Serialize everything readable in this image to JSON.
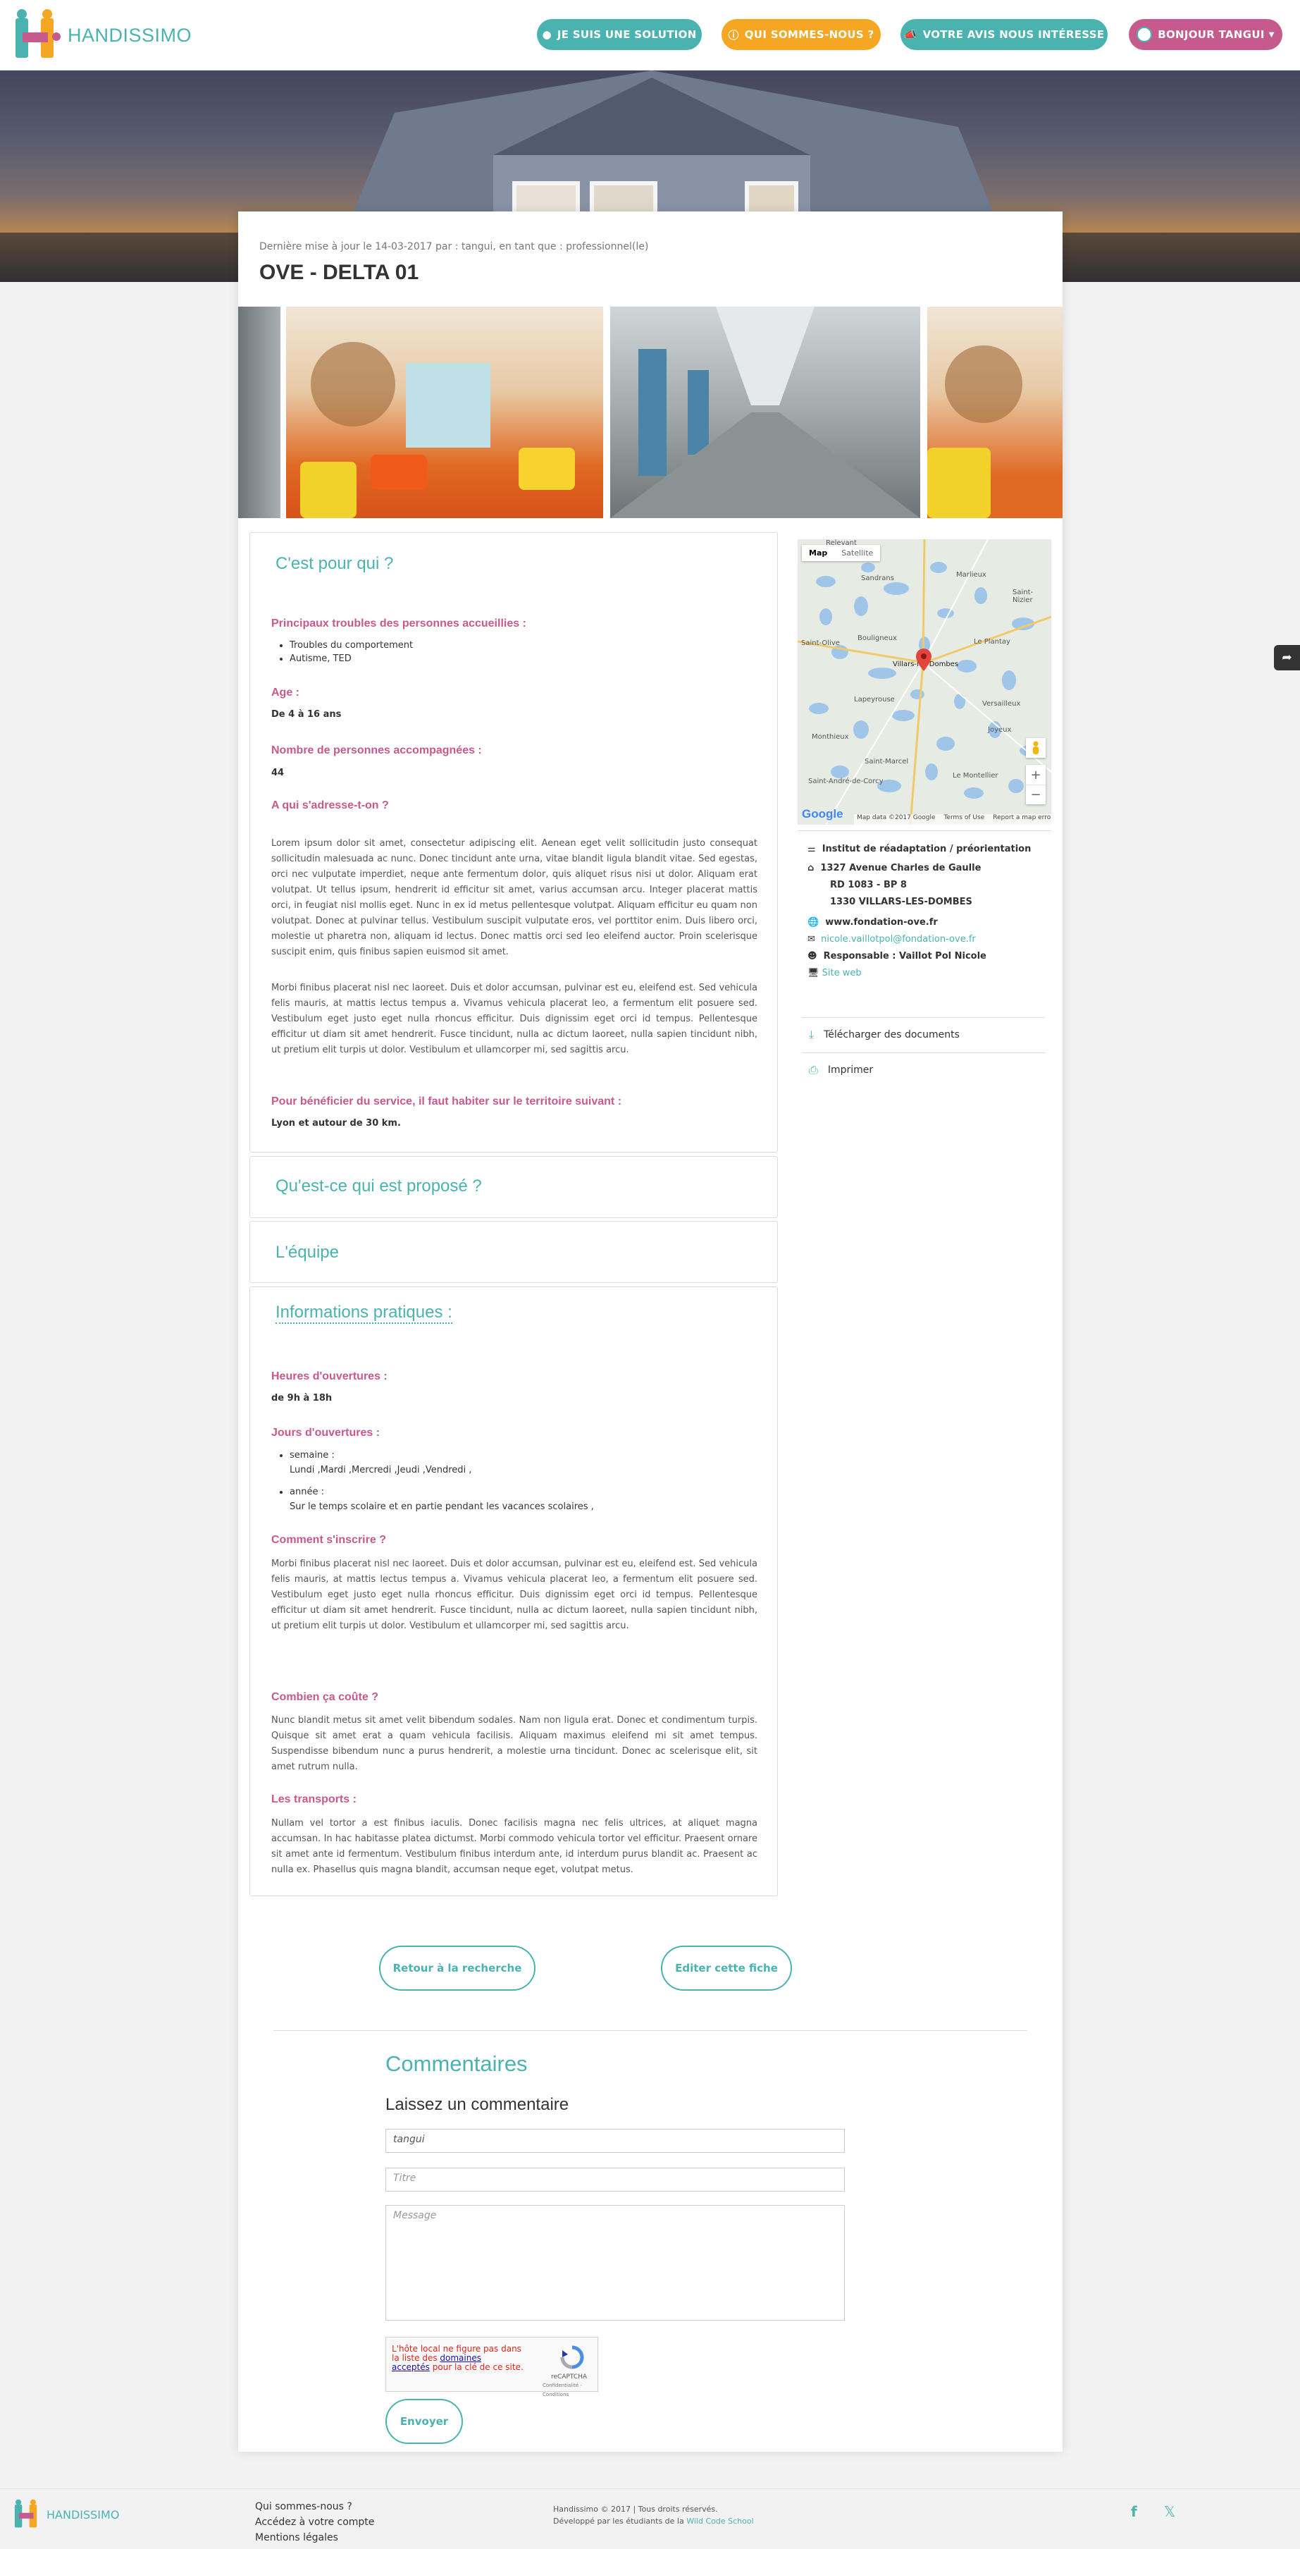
{
  "nav": {
    "brand": "HANDISSIMO",
    "btn_solution": "JE SUIS UNE SOLUTION",
    "btn_qui": "QUI SOMMES-NOUS ?",
    "btn_avis": "VOTRE AVIS NOUS INTÉRESSE",
    "btn_user": "BONJOUR TANGUI",
    "colors": {
      "teal": "#4ab3b0",
      "orange": "#f5a623",
      "pink": "#c65a8c"
    }
  },
  "header": {
    "updated": "Dernière mise à jour le 14-03-2017 par : tangui, en tant que : professionnel(le)",
    "title": "OVE - DELTA 01"
  },
  "who": {
    "heading": "C'est pour qui ?",
    "troubles_label": "Principaux troubles des personnes accueillies :",
    "troubles": [
      "Troubles du comportement",
      "Autisme, TED"
    ],
    "age_label": "Age :",
    "age_value": "De 4 à 16 ans",
    "count_label": "Nombre de personnes accompagnées :",
    "count_value": "44",
    "target_label": "A qui s'adresse-t-on ?",
    "target_p1": "Lorem ipsum dolor sit amet, consectetur adipiscing elit. Aenean eget velit sollicitudin justo consequat sollicitudin malesuada ac nunc. Donec tincidunt ante urna, vitae blandit ligula blandit vitae. Sed egestas, orci nec vulputate imperdiet, neque ante fermentum dolor, quis aliquet risus nisi ut dolor. Aliquam erat volutpat. Ut tellus ipsum, hendrerit id efficitur sit amet, varius accumsan arcu. Integer placerat mattis orci, in feugiat nisl mollis eget. Nunc in ex id metus pellentesque volutpat. Aliquam efficitur eu quam non volutpat. Donec at pulvinar tellus. Vestibulum suscipit vulputate eros, vel porttitor enim. Duis libero orci, molestie ut pharetra non, aliquam id lectus. Donec mattis orci sed leo eleifend auctor. Proin scelerisque suscipit enim, quis finibus sapien euismod sit amet.",
    "target_p2": "Morbi finibus placerat nisl nec laoreet. Duis et dolor accumsan, pulvinar est eu, eleifend est. Sed vehicula felis mauris, at mattis lectus tempus a. Vivamus vehicula placerat leo, a fermentum elit posuere sed. Vestibulum eget justo eget nulla rhoncus efficitur. Duis dignissim eget orci id tempus. Pellentesque efficitur ut diam sit amet hendrerit. Fusce tincidunt, nulla ac dictum laoreet, nulla sapien tincidunt nibh, ut pretium elit turpis ut dolor. Vestibulum et ullamcorper mi, sed sagittis arcu.",
    "territory_label": "Pour bénéficier du service, il faut habiter sur le territoire suivant :",
    "territory_value": "Lyon et autour de 30 km."
  },
  "proposed": {
    "heading": "Qu'est-ce qui est proposé ?"
  },
  "team": {
    "heading": "L'équipe"
  },
  "practical": {
    "heading": "Informations pratiques :",
    "hours_label": "Heures d'ouvertures :",
    "hours_value": "de 9h à 18h",
    "days_label": "Jours d'ouvertures :",
    "week_label": "semaine :",
    "week_value": "Lundi ,Mardi ,Mercredi ,Jeudi ,Vendredi ,",
    "year_label": "année :",
    "year_value": "Sur le temps scolaire et en partie pendant les vacances scolaires ,",
    "register_label": "Comment s'inscrire ?",
    "register_text": "Morbi finibus placerat nisl nec laoreet. Duis et dolor accumsan, pulvinar est eu, eleifend est. Sed vehicula felis mauris, at mattis lectus tempus a. Vivamus vehicula placerat leo, a fermentum elit posuere sed. Vestibulum eget justo eget nulla rhoncus efficitur. Duis dignissim eget orci id tempus. Pellentesque efficitur ut diam sit amet hendrerit. Fusce tincidunt, nulla ac dictum laoreet, nulla sapien tincidunt nibh, ut pretium elit turpis ut dolor. Vestibulum et ullamcorper mi, sed sagittis arcu.",
    "cost_label": "Combien ça coûte ?",
    "cost_text": "Nunc blandit metus sit amet velit bibendum sodales. Nam non ligula erat. Donec et condimentum turpis. Quisque sit amet erat a quam vehicula facilisis. Aliquam maximus eleifend mi sit amet tempus. Suspendisse bibendum nunc a purus hendrerit, a molestie urna tincidunt. Donec ac scelerisque elit, sit amet rutrum nulla.",
    "transport_label": "Les transports :",
    "transport_text": "Nullam vel tortor a est finibus iaculis. Donec facilisis magna nec felis ultrices, at aliquet magna accumsan. In hac habitasse platea dictumst. Morbi commodo vehicula tortor vel efficitur. Praesent ornare sit amet ante id fermentum. Vestibulum finibus interdum ante, id interdum purus blandit ac. Praesent ac nulla ex. Phasellus quis magna blandit, accumsan neque eget, volutpat metus."
  },
  "map": {
    "tab_map": "Map",
    "tab_satellite": "Satellite",
    "places": [
      "Sandrans",
      "Marlieux",
      "Saint-Nizier",
      "Le Plantay",
      "Bouligneux",
      "Saint-Olive",
      "Villars-les-Dombes",
      "Versailleux",
      "Lapeyrouse",
      "Joyeux",
      "Monthieux",
      "Saint-Marcel",
      "Le Montellier",
      "Saint-André-de-Corcy",
      "Relevant"
    ],
    "google": "Google",
    "credit": "Map data ©2017 Google",
    "terms": "Terms of Use",
    "report": "Report a map error"
  },
  "contact": {
    "type": "Institut de réadaptation / préorientation",
    "address1": "1327 Avenue Charles de Gaulle",
    "address2": "RD 1083 - BP 8",
    "address3": "1330 VILLARS-LES-DOMBES",
    "website": "www.fondation-ove.fr",
    "email": "nicole.vaillotpol@fondation-ove.fr",
    "manager": "Responsable : Vaillot Pol Nicole",
    "site_link": "Site web",
    "download": "Télécharger des documents",
    "print": "Imprimer"
  },
  "actions": {
    "back": "Retour à la recherche",
    "edit": "Editer cette fiche"
  },
  "comments": {
    "heading": "Commentaires",
    "subheading": "Laissez un commentaire",
    "name_value": "tangui",
    "title_placeholder": "Titre",
    "message_placeholder": "Message",
    "captcha_error_1": "L'hôte local ne figure pas dans",
    "captcha_error_2": "la liste des",
    "captcha_link_1": "domaines",
    "captcha_link_2": "acceptés",
    "captcha_error_3": "pour la clé de ce site.",
    "captcha_brand": "reCAPTCHA",
    "captcha_terms": "Confidentialité - Conditions",
    "send": "Envoyer"
  },
  "footer": {
    "brand": "HANDISSIMO",
    "link1": "Qui sommes-nous ?",
    "link2": "Accédez à votre compte",
    "link3": "Mentions légales",
    "copyright": "Handissimo © 2017 | Tous droits réservés.",
    "dev_prefix": "Développé par les étudiants de la",
    "dev_link": "Wild Code School"
  }
}
